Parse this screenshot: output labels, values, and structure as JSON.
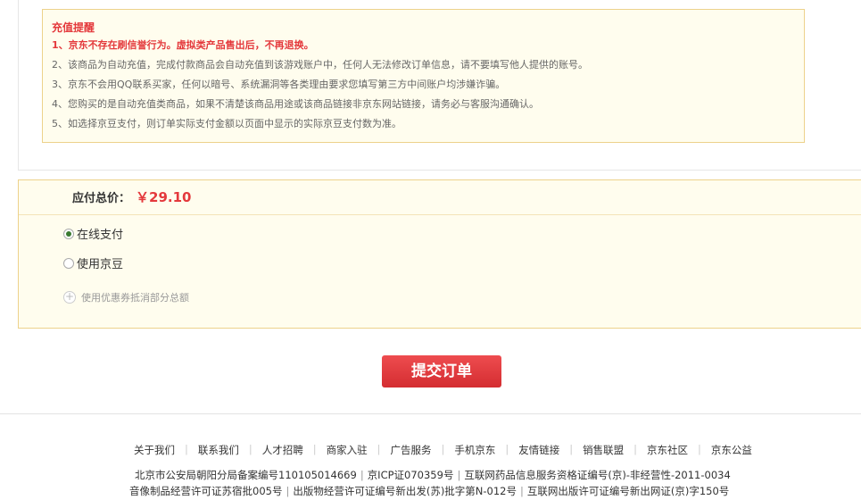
{
  "notice": {
    "title": "充值提醒",
    "lines": [
      "1、京东不存在刷信誉行为。虚拟类产品售出后，不再退换。",
      "2、该商品为自动充值，完成付款商品会自动充值到该游戏账户中，任何人无法修改订单信息，请不要填写他人提供的账号。",
      "3、京东不会用QQ联系买家，任何以暗号、系统漏洞等各类理由要求您填写第三方中间账户均涉嫌诈骗。",
      "4、您购买的是自动充值类商品，如果不清楚该商品用途或该商品链接非京东网站链接，请务必与客服沟通确认。",
      "5、如选择京豆支付，则订单实际支付金额以页面中显示的实际京豆支付数为准。"
    ]
  },
  "payment": {
    "total_label": "应付总价：",
    "total_price": "￥29.10",
    "option_online": "在线支付",
    "option_jingdou": "使用京豆",
    "coupon": "使用优惠券抵消部分总额"
  },
  "submit_label": "提交订单",
  "footer": {
    "links": [
      "关于我们",
      "联系我们",
      "人才招聘",
      "商家入驻",
      "广告服务",
      "手机京东",
      "友情链接",
      "销售联盟",
      "京东社区",
      "京东公益"
    ],
    "line1": [
      "北京市公安局朝阳分局备案编号110105014669",
      "京ICP证070359号",
      "互联网药品信息服务资格证编号(京)-非经营性-2011-0034"
    ],
    "line2": [
      "音像制品经营许可证苏宿批005号",
      "出版物经营许可证编号新出发(苏)批字第N-012号",
      "互联网出版许可证编号新出网证(京)字150号"
    ]
  },
  "colors": {
    "accent": "#e4393c",
    "notice_bg": "#fffdee",
    "notice_border": "#edd28b"
  }
}
